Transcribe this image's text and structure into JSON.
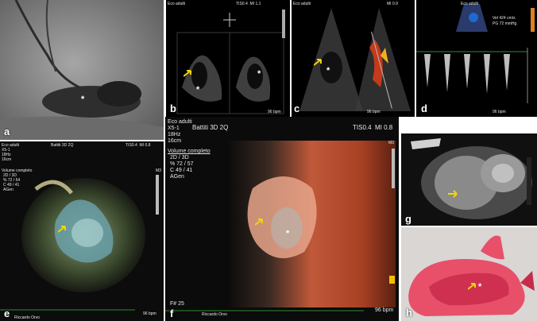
{
  "labels": {
    "a": "a",
    "b": "b",
    "c": "c",
    "d": "d",
    "e": "e",
    "f": "f",
    "g": "g",
    "h": "h"
  },
  "star": "*",
  "panel_b": {
    "top_title": "Eco adulti",
    "top_right": "TIS0.4  MI 1.1",
    "scale_text": "96 bpm"
  },
  "panel_c": {
    "top_left": "Eco adulti",
    "top_right": "MI 0.9",
    "bottom_text": "96 bpm"
  },
  "panel_d": {
    "top_left": "Eco adulti",
    "vel": "Vel 424 cm/s",
    "pg": "PG 72 mmHg",
    "bottom_text": "96 bpm"
  },
  "panel_e": {
    "line1": "Eco adulti",
    "line2": "X5-1",
    "line3": "18Hz",
    "line4": "16cm",
    "top_mid": "Battiti 3D 2Q",
    "top_right": "TIS0.4  MI 0.8",
    "mode": "Volume completo",
    "params": "2D / 3D\n% 72 / 54\nC 49 / 41\nAGen",
    "m3": "M3",
    "bpm": "96 bpm",
    "footer": "Riccardo Orvo"
  },
  "panel_f": {
    "line1": "Eco adulti",
    "line2": "X5-1",
    "line3": "18Hz",
    "line4": "16cm",
    "battiti": "Battiti 3D 2Q",
    "tis": "TIS0.4  MI 0.8",
    "mode": "Volume completo",
    "params": "2D / 3D\n% 72 / 57\nC 49 / 41\nAGen",
    "m3": "M3",
    "frame": "F# 25",
    "bpm": "96 bpm",
    "footer": "Riccardo Orvo"
  }
}
